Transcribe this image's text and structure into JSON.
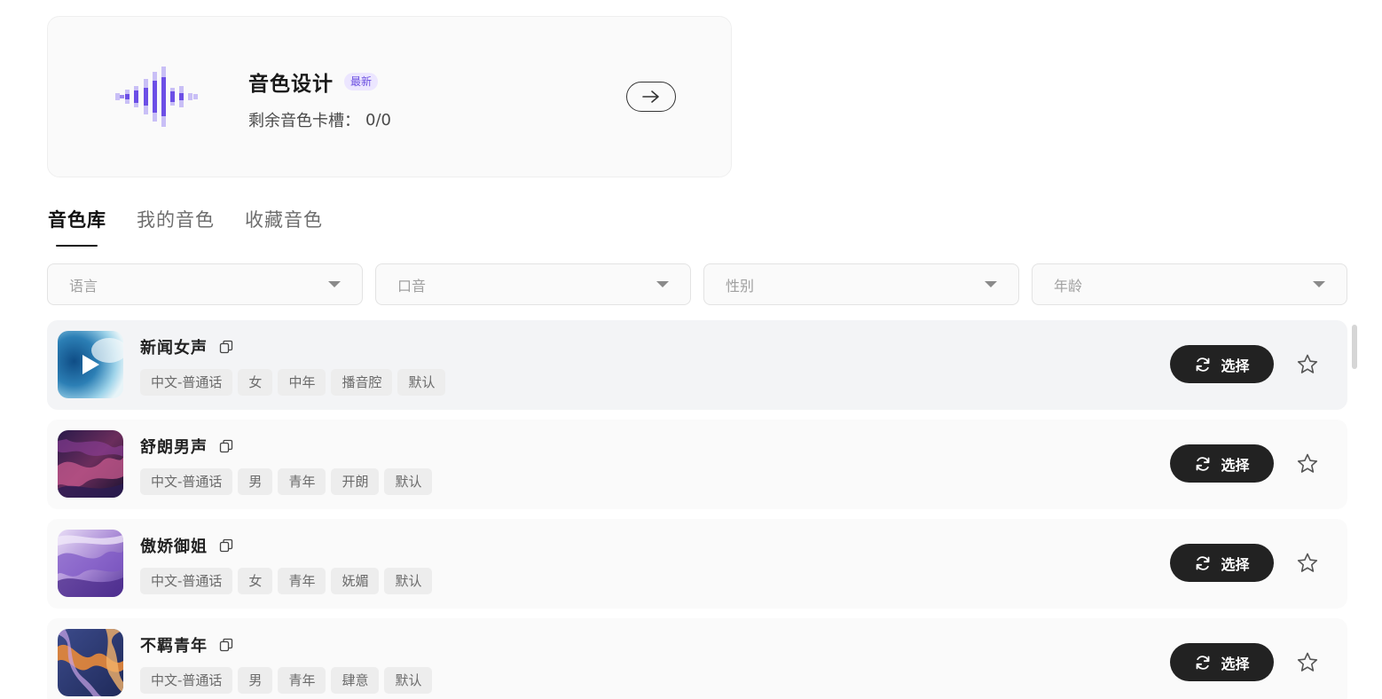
{
  "design_card": {
    "title": "音色设计",
    "badge": "最新",
    "slots_label": "剩余音色卡槽：",
    "slots_value": "0/0",
    "accent_color": "#6c4fe6"
  },
  "tabs": [
    {
      "label": "音色库",
      "active": true
    },
    {
      "label": "我的音色",
      "active": false
    },
    {
      "label": "收藏音色",
      "active": false
    }
  ],
  "filters": [
    {
      "placeholder": "语言"
    },
    {
      "placeholder": "口音"
    },
    {
      "placeholder": "性别"
    },
    {
      "placeholder": "年龄"
    }
  ],
  "voices": [
    {
      "name": "新闻女声",
      "tags": [
        "中文-普通话",
        "女",
        "中年",
        "播音腔",
        "默认"
      ],
      "select_label": "选择",
      "cover": "blue-play",
      "active": true
    },
    {
      "name": "舒朗男声",
      "tags": [
        "中文-普通话",
        "男",
        "青年",
        "开朗",
        "默认"
      ],
      "select_label": "选择",
      "cover": "dark-purple",
      "active": false
    },
    {
      "name": "傲娇御姐",
      "tags": [
        "中文-普通话",
        "女",
        "青年",
        "妩媚",
        "默认"
      ],
      "select_label": "选择",
      "cover": "lavender",
      "active": false
    },
    {
      "name": "不羁青年",
      "tags": [
        "中文-普通话",
        "男",
        "青年",
        "肆意",
        "默认"
      ],
      "select_label": "选择",
      "cover": "orange-blue",
      "active": false
    }
  ]
}
